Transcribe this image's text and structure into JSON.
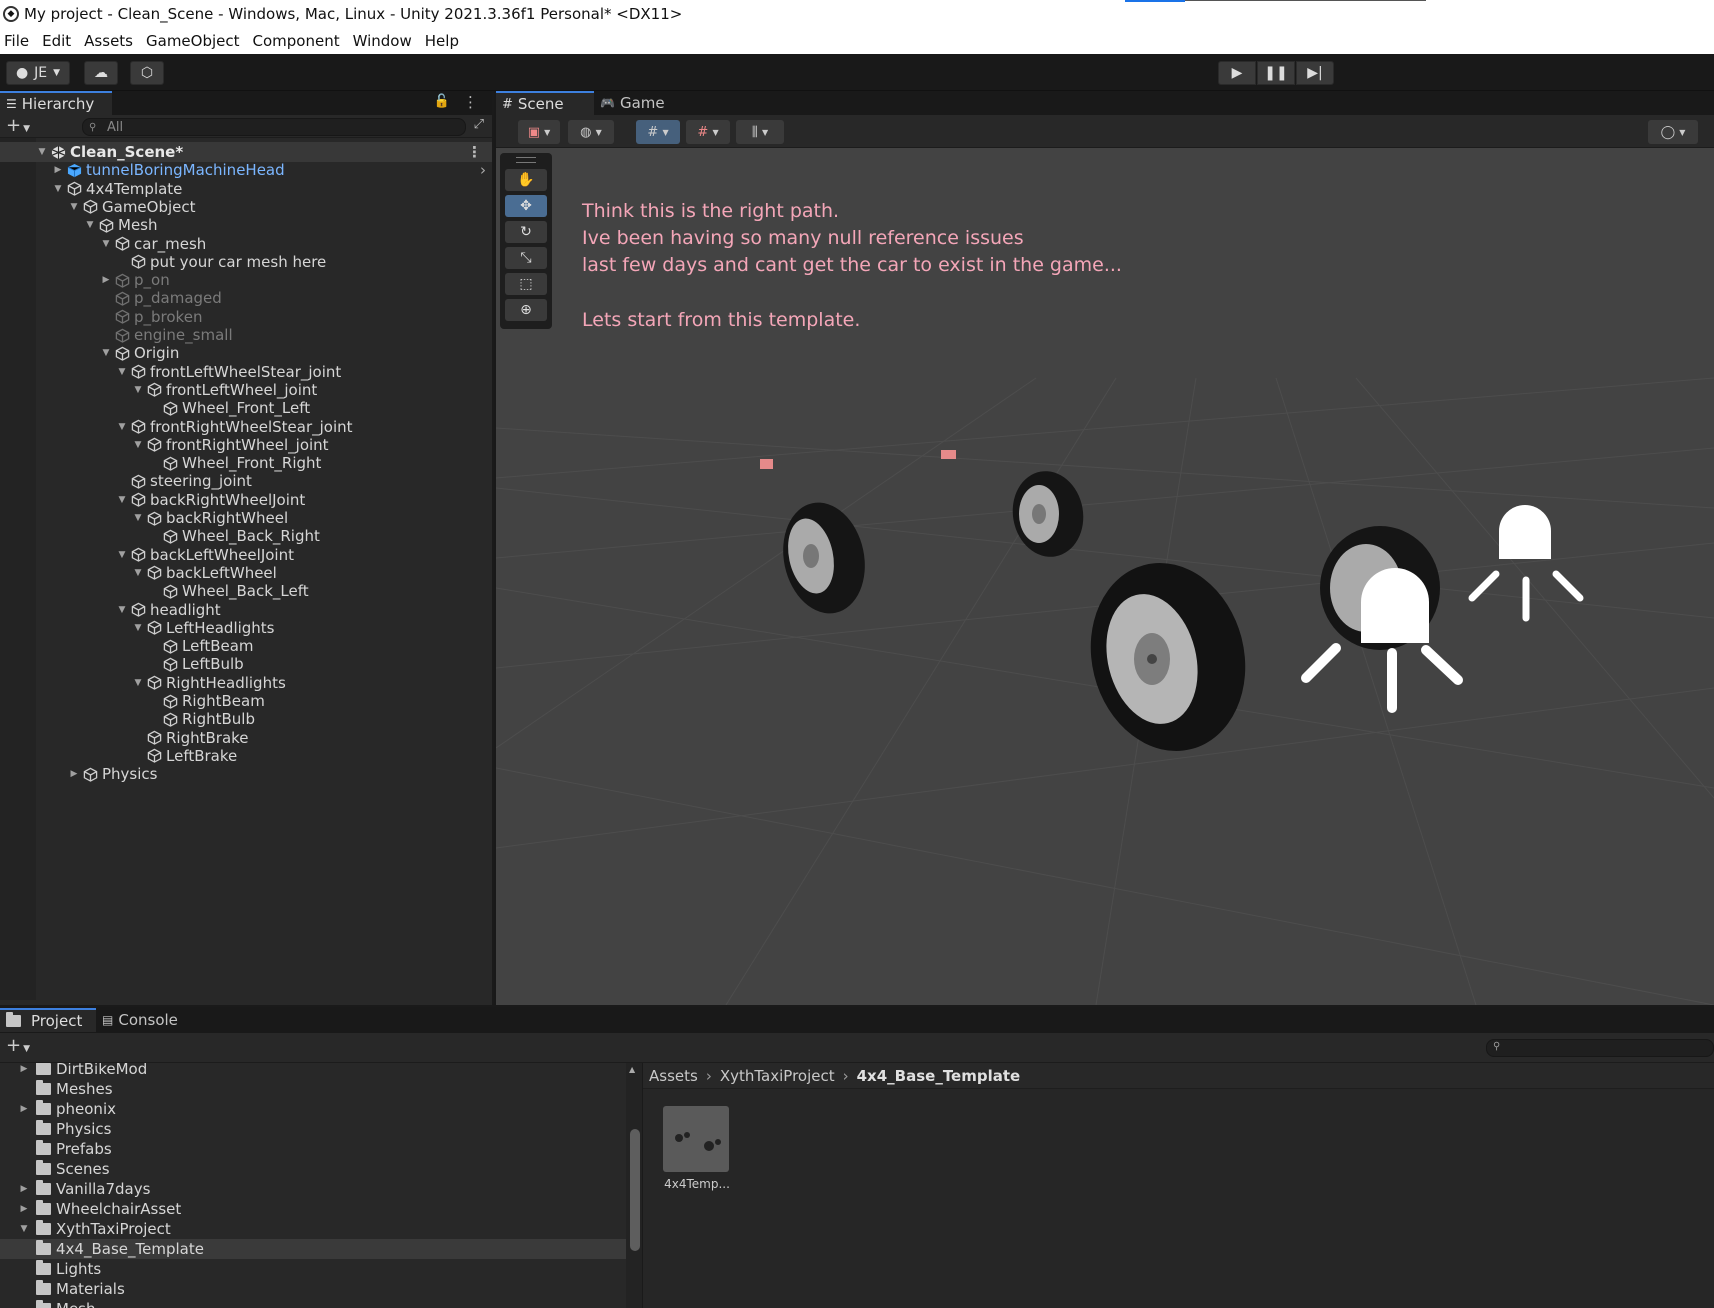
{
  "window": {
    "title": "My project - Clean_Scene - Windows, Mac, Linux - Unity 2021.3.36f1 Personal* <DX11>"
  },
  "menu": [
    "File",
    "Edit",
    "Assets",
    "GameObject",
    "Component",
    "Window",
    "Help"
  ],
  "toolbar": {
    "account": "JE",
    "play_icon": "play-icon",
    "pause_icon": "pause-icon",
    "step_icon": "step-icon"
  },
  "hierarchy": {
    "tab": "Hierarchy",
    "search_placeholder": "All",
    "scene": "Clean_Scene*",
    "items": [
      {
        "label": "tunnelBoringMachineHead",
        "depth": 1,
        "arrow": "right",
        "style": "prefab"
      },
      {
        "label": "4x4Template",
        "depth": 1,
        "arrow": "down",
        "style": "normal"
      },
      {
        "label": "GameObject",
        "depth": 2,
        "arrow": "down",
        "style": "normal"
      },
      {
        "label": "Mesh",
        "depth": 3,
        "arrow": "down",
        "style": "normal"
      },
      {
        "label": "car_mesh",
        "depth": 4,
        "arrow": "down",
        "style": "normal"
      },
      {
        "label": "put your car mesh here",
        "depth": 5,
        "arrow": "",
        "style": "normal"
      },
      {
        "label": "p_on",
        "depth": 4,
        "arrow": "right",
        "style": "dim"
      },
      {
        "label": "p_damaged",
        "depth": 4,
        "arrow": "",
        "style": "dim"
      },
      {
        "label": "p_broken",
        "depth": 4,
        "arrow": "",
        "style": "dim"
      },
      {
        "label": "engine_small",
        "depth": 4,
        "arrow": "",
        "style": "dim"
      },
      {
        "label": "Origin",
        "depth": 4,
        "arrow": "down",
        "style": "normal"
      },
      {
        "label": "frontLeftWheelStear_joint",
        "depth": 5,
        "arrow": "down",
        "style": "normal"
      },
      {
        "label": "frontLeftWheel_joint",
        "depth": 6,
        "arrow": "down",
        "style": "normal"
      },
      {
        "label": "Wheel_Front_Left",
        "depth": 7,
        "arrow": "",
        "style": "normal"
      },
      {
        "label": "frontRightWheelStear_joint",
        "depth": 5,
        "arrow": "down",
        "style": "normal"
      },
      {
        "label": "frontRightWheel_joint",
        "depth": 6,
        "arrow": "down",
        "style": "normal"
      },
      {
        "label": "Wheel_Front_Right",
        "depth": 7,
        "arrow": "",
        "style": "normal"
      },
      {
        "label": "steering_joint",
        "depth": 5,
        "arrow": "",
        "style": "normal"
      },
      {
        "label": "backRightWheelJoint",
        "depth": 5,
        "arrow": "down",
        "style": "normal"
      },
      {
        "label": "backRightWheel",
        "depth": 6,
        "arrow": "down",
        "style": "normal"
      },
      {
        "label": "Wheel_Back_Right",
        "depth": 7,
        "arrow": "",
        "style": "normal"
      },
      {
        "label": "backLeftWheelJoint",
        "depth": 5,
        "arrow": "down",
        "style": "normal"
      },
      {
        "label": "backLeftWheel",
        "depth": 6,
        "arrow": "down",
        "style": "normal"
      },
      {
        "label": "Wheel_Back_Left",
        "depth": 7,
        "arrow": "",
        "style": "normal"
      },
      {
        "label": "headlight",
        "depth": 5,
        "arrow": "down",
        "style": "normal"
      },
      {
        "label": "LeftHeadlights",
        "depth": 6,
        "arrow": "down",
        "style": "normal"
      },
      {
        "label": "LeftBeam",
        "depth": 7,
        "arrow": "",
        "style": "normal"
      },
      {
        "label": "LeftBulb",
        "depth": 7,
        "arrow": "",
        "style": "normal"
      },
      {
        "label": "RightHeadlights",
        "depth": 6,
        "arrow": "down",
        "style": "normal"
      },
      {
        "label": "RightBeam",
        "depth": 7,
        "arrow": "",
        "style": "normal"
      },
      {
        "label": "RightBulb",
        "depth": 7,
        "arrow": "",
        "style": "normal"
      },
      {
        "label": "RightBrake",
        "depth": 6,
        "arrow": "",
        "style": "normal"
      },
      {
        "label": "LeftBrake",
        "depth": 6,
        "arrow": "",
        "style": "normal"
      },
      {
        "label": "Physics",
        "depth": 2,
        "arrow": "right",
        "style": "normal"
      }
    ]
  },
  "scene_view": {
    "tabs": [
      "Scene",
      "Game"
    ],
    "notes": [
      "Think this is the right path.",
      "Ive been having so many null reference issues",
      "last few days and cant get the car to exist in the game...",
      "",
      "Lets start from this template."
    ],
    "colors": {
      "note": "#f4a6b8",
      "viewport": "#434343"
    }
  },
  "project": {
    "tabs": [
      "Project",
      "Console"
    ],
    "folders": [
      {
        "label": "DirtBikeMod",
        "arrow": "right",
        "depth": 1,
        "open": false
      },
      {
        "label": "Meshes",
        "arrow": "",
        "depth": 1,
        "open": false
      },
      {
        "label": "pheonix",
        "arrow": "right",
        "depth": 1,
        "open": false
      },
      {
        "label": "Physics",
        "arrow": "",
        "depth": 1,
        "open": false
      },
      {
        "label": "Prefabs",
        "arrow": "",
        "depth": 1,
        "open": false
      },
      {
        "label": "Scenes",
        "arrow": "",
        "depth": 1,
        "open": false
      },
      {
        "label": "Vanilla7days",
        "arrow": "right",
        "depth": 1,
        "open": false
      },
      {
        "label": "WheelchairAsset",
        "arrow": "right",
        "depth": 1,
        "open": false
      },
      {
        "label": "XythTaxiProject",
        "arrow": "down",
        "depth": 1,
        "open": true
      },
      {
        "label": "4x4_Base_Template",
        "arrow": "",
        "depth": 2,
        "open": false,
        "selected": true
      },
      {
        "label": "Lights",
        "arrow": "",
        "depth": 2,
        "open": false
      },
      {
        "label": "Materials",
        "arrow": "",
        "depth": 2,
        "open": false
      },
      {
        "label": "Mesh",
        "arrow": "",
        "depth": 2,
        "open": false
      }
    ],
    "breadcrumb": [
      "Assets",
      "XythTaxiProject",
      "4x4_Base_Template"
    ],
    "assets": [
      {
        "label": "4x4Temp..."
      }
    ]
  }
}
